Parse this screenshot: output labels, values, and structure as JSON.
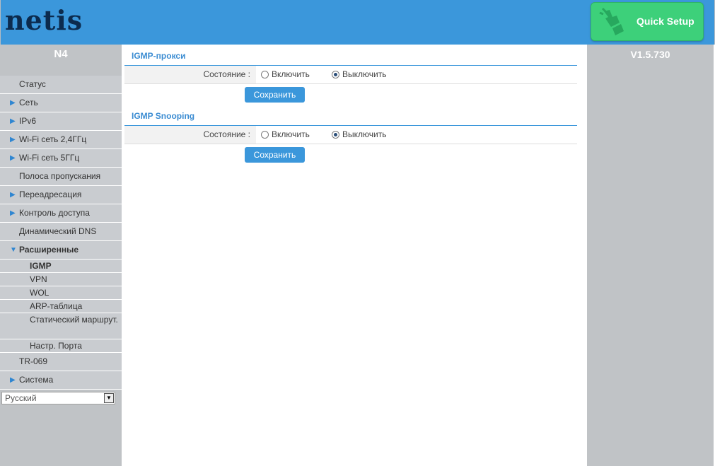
{
  "header": {
    "logo": "netis",
    "quick_setup_label": "Quick Setup"
  },
  "sidebar": {
    "model": "N4",
    "items": [
      {
        "label": "Статус",
        "arrow": false
      },
      {
        "label": "Сеть",
        "arrow": true
      },
      {
        "label": "IPv6",
        "arrow": true
      },
      {
        "label": "Wi-Fi сеть 2,4ГГц",
        "arrow": true
      },
      {
        "label": "Wi-Fi сеть 5ГГц",
        "arrow": true
      },
      {
        "label": "Полоса пропускания",
        "arrow": false
      },
      {
        "label": "Переадресация",
        "arrow": true
      },
      {
        "label": "Контроль доступа",
        "arrow": true
      },
      {
        "label": "Динамический DNS",
        "arrow": false
      },
      {
        "label": "Расширенные",
        "arrow": true,
        "expanded": true
      }
    ],
    "subitems": [
      "IGMP",
      "VPN",
      "WOL",
      "ARP-таблица",
      "Статический маршрут.",
      "Настр. Порта"
    ],
    "after_items": [
      {
        "label": "TR-069",
        "arrow": false
      },
      {
        "label": "Система",
        "arrow": true
      }
    ],
    "language": "Русский"
  },
  "version": "V1.5.730",
  "igmp_proxy": {
    "title": "IGMP-прокси",
    "state_label": "Состояние :",
    "enable_label": "Включить",
    "disable_label": "Выключить",
    "selected": "disable",
    "save_label": "Сохранить"
  },
  "igmp_snooping": {
    "title": "IGMP Snooping",
    "state_label": "Состояние :",
    "enable_label": "Включить",
    "disable_label": "Выключить",
    "selected": "disable",
    "save_label": "Сохранить"
  },
  "colors": {
    "header_blue": "#3b97db",
    "quick_setup_green": "#3dd07a",
    "sidebar_gray": "#c0c3c6",
    "accent_link": "#3b8cd2"
  }
}
